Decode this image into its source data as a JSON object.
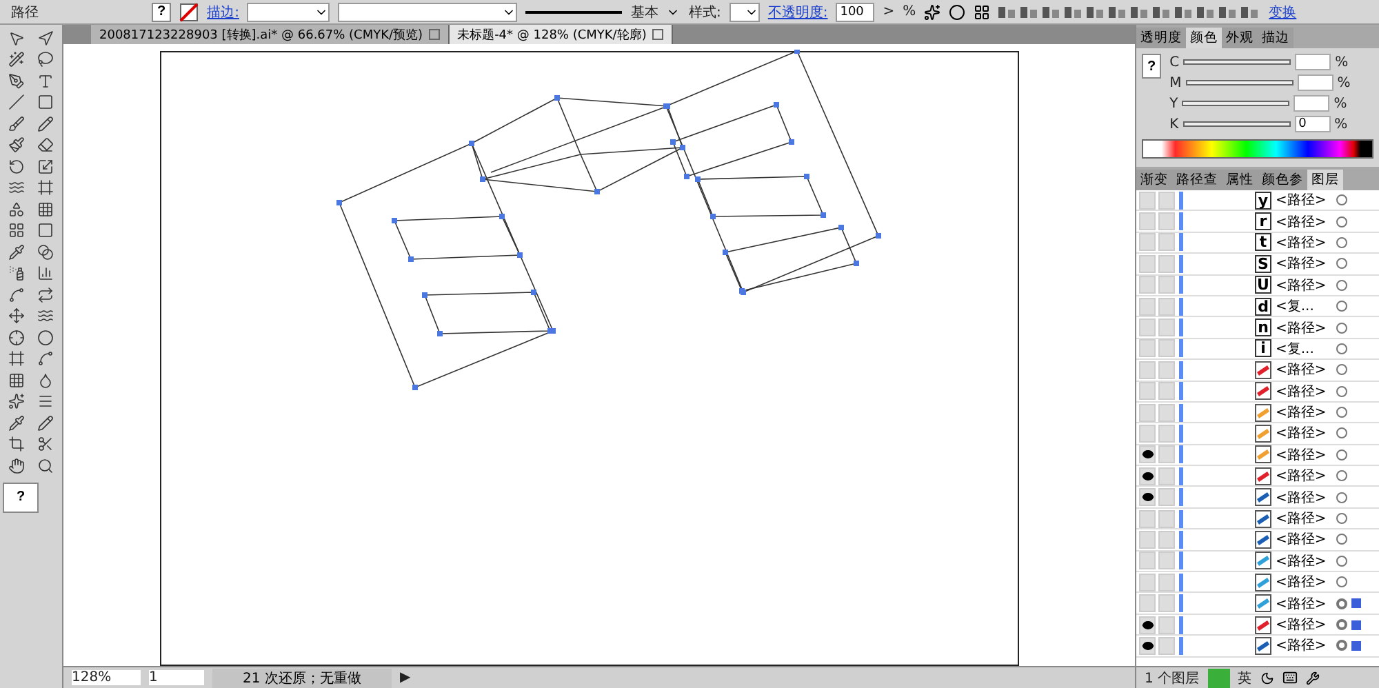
{
  "control_bar": {
    "selection_label": "路径",
    "fill_swatch": "?",
    "stroke_label": "描边:",
    "brush_label": "基本",
    "style_label": "样式:",
    "opacity_label": "不透明度:",
    "opacity_value": "100",
    "opacity_arrow": ">",
    "percent": "%",
    "transform_link": "变换"
  },
  "doc_tabs": [
    {
      "label": "200817123228903 [转换].ai* @ 66.67% (CMYK/预览)",
      "selected": false
    },
    {
      "label": "未标题-4* @ 128% (CMYK/轮廓)",
      "selected": true
    }
  ],
  "tools": {
    "fill_swatch": "?"
  },
  "color_panel": {
    "tabs": [
      {
        "label": "透明度",
        "selected": false
      },
      {
        "label": "颜色",
        "selected": true
      },
      {
        "label": "外观",
        "selected": false
      },
      {
        "label": "描边",
        "selected": false
      }
    ],
    "swatch": "?",
    "sliders": [
      {
        "name": "C"
      },
      {
        "name": "M"
      },
      {
        "name": "Y"
      },
      {
        "name": "K",
        "value": "0"
      }
    ],
    "percent": "%"
  },
  "layers_panel": {
    "tabs": [
      {
        "label": "渐变",
        "selected": false
      },
      {
        "label": "路径查",
        "selected": false
      },
      {
        "label": "属性",
        "selected": false
      },
      {
        "label": "颜色参",
        "selected": false
      },
      {
        "label": "图层",
        "selected": true
      }
    ],
    "rows": [
      {
        "kind": "glyph",
        "glyph": "y",
        "name": "<路径>",
        "visible": false,
        "selected": false
      },
      {
        "kind": "glyph",
        "glyph": "r",
        "name": "<路径>",
        "visible": false,
        "selected": false
      },
      {
        "kind": "glyph",
        "glyph": "t",
        "name": "<路径>",
        "visible": false,
        "selected": false
      },
      {
        "kind": "glyph",
        "glyph": "S",
        "name": "<路径>",
        "visible": false,
        "selected": false
      },
      {
        "kind": "glyph",
        "glyph": "U",
        "name": "<路径>",
        "visible": false,
        "selected": false
      },
      {
        "kind": "glyph",
        "glyph": "d",
        "name": "<复...",
        "visible": false,
        "selected": false
      },
      {
        "kind": "glyph",
        "glyph": "n",
        "name": "<路径>",
        "visible": false,
        "selected": false
      },
      {
        "kind": "glyph",
        "glyph": "i",
        "name": "<复...",
        "visible": false,
        "selected": false
      },
      {
        "kind": "stroke",
        "color": "#e0202a",
        "name": "<路径>",
        "visible": false,
        "selected": false
      },
      {
        "kind": "stroke",
        "color": "#e0202a",
        "name": "<路径>",
        "visible": false,
        "selected": false
      },
      {
        "kind": "stroke",
        "color": "#f0a030",
        "name": "<路径>",
        "visible": false,
        "selected": false
      },
      {
        "kind": "stroke",
        "color": "#f0a030",
        "name": "<路径>",
        "visible": false,
        "selected": false
      },
      {
        "kind": "stroke",
        "color": "#f0a030",
        "name": "<路径>",
        "visible": true,
        "selected": false
      },
      {
        "kind": "stroke",
        "color": "#e0202a",
        "name": "<路径>",
        "visible": true,
        "selected": false
      },
      {
        "kind": "stroke",
        "color": "#1a5fb4",
        "name": "<路径>",
        "visible": true,
        "selected": false
      },
      {
        "kind": "stroke",
        "color": "#1a5fb4",
        "name": "<路径>",
        "visible": false,
        "selected": false
      },
      {
        "kind": "stroke",
        "color": "#1a5fb4",
        "name": "<路径>",
        "visible": false,
        "selected": false
      },
      {
        "kind": "stroke",
        "color": "#30a0d8",
        "name": "<路径>",
        "visible": false,
        "selected": false
      },
      {
        "kind": "stroke",
        "color": "#30a0d8",
        "name": "<路径>",
        "visible": false,
        "selected": false
      },
      {
        "kind": "stroke",
        "color": "#30a0d8",
        "name": "<路径>",
        "visible": false,
        "selected": true
      },
      {
        "kind": "stroke",
        "color": "#e0202a",
        "name": "<路径>",
        "visible": true,
        "selected": true
      },
      {
        "kind": "stroke",
        "color": "#1a5fb4",
        "name": "<路径>",
        "visible": true,
        "selected": true
      }
    ],
    "footer": "1 个图层"
  },
  "status_bar": {
    "zoom": "128%",
    "page": "1",
    "message": "21 次还原；无重做",
    "play": "▶"
  },
  "ime_bar": {
    "mode": "英"
  }
}
